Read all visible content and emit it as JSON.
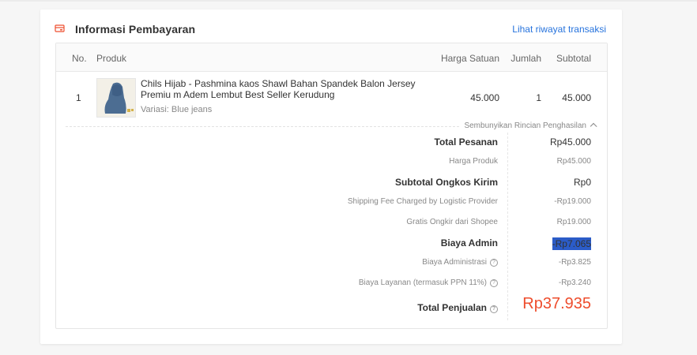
{
  "section": {
    "title": "Informasi Pembayaran",
    "history_link": "Lihat riwayat transaksi"
  },
  "table": {
    "headers": {
      "no": "No.",
      "product": "Produk",
      "unit_price": "Harga Satuan",
      "qty": "Jumlah",
      "subtotal": "Subtotal"
    },
    "rows": [
      {
        "no": "1",
        "name": "Chils Hijab - Pashmina kaos Shawl Bahan Spandek Balon Jersey Premiu m Adem Lembut Best Seller Kerudung",
        "variant": "Variasi: Blue jeans",
        "unit_price": "45.000",
        "qty": "1",
        "subtotal": "45.000"
      }
    ]
  },
  "toggle_label": "Sembunyikan Rincian Penghasilan",
  "breakdown": {
    "total_pesanan": {
      "label": "Total Pesanan",
      "value": "Rp45.000"
    },
    "harga_produk": {
      "label": "Harga Produk",
      "value": "Rp45.000"
    },
    "subtotal_ongkir": {
      "label": "Subtotal Ongkos Kirim",
      "value": "Rp0"
    },
    "shipping_fee": {
      "label": "Shipping Fee Charged by Logistic Provider",
      "value": "-Rp19.000"
    },
    "gratis_ongkir": {
      "label": "Gratis Ongkir dari Shopee",
      "value": "Rp19.000"
    },
    "biaya_admin": {
      "label": "Biaya Admin",
      "value": "-Rp7.065"
    },
    "biaya_administrasi": {
      "label": "Biaya Administrasi",
      "value": "-Rp3.825"
    },
    "biaya_layanan": {
      "label": "Biaya Layanan (termasuk PPN 11%)",
      "value": "-Rp3.240"
    },
    "total_penjualan": {
      "label": "Total Penjualan",
      "value": "Rp37.935"
    }
  },
  "colors": {
    "accent_link": "#2673dd",
    "total_red": "#ee4d2d",
    "selection": "#2b5cc8"
  },
  "icons": {
    "section": "payment-card-icon",
    "help": "question-circle-icon",
    "toggle": "chevron-up-icon"
  }
}
